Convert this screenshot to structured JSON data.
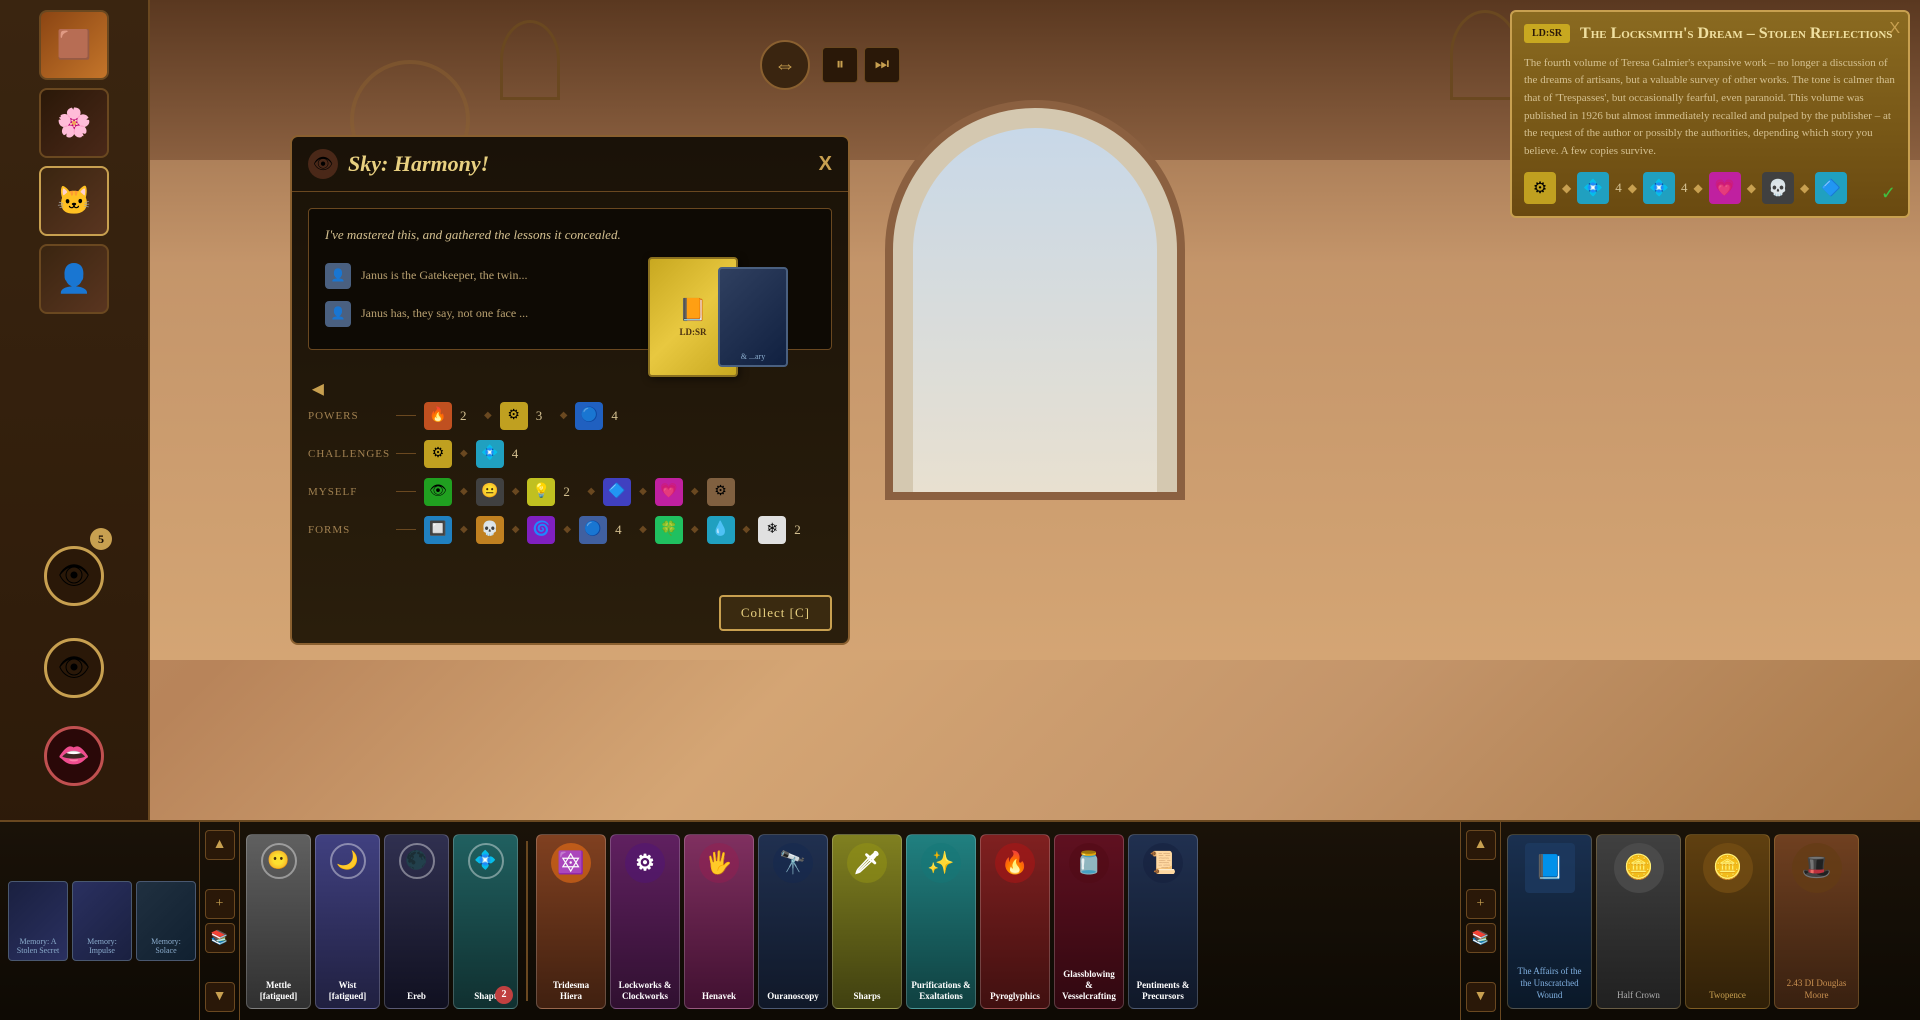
{
  "dialog": {
    "title": "Sky: Harmony!",
    "close_label": "X",
    "main_text": "I've mastered this, and gathered the lessons it concealed.",
    "list_items": [
      "Janus is the Gatekeeper, the twin...",
      "Janus has, they say, not one face ..."
    ],
    "collect_button": "Collect [C]",
    "nav_arrow": "◄",
    "stats": {
      "powers_label": "Powers",
      "challenges_label": "Challenges",
      "myself_label": "Myself",
      "forms_label": "Forms",
      "powers_values": [
        "2",
        "3",
        "4"
      ],
      "challenges_values": [
        "4"
      ],
      "myself_values": [
        "2"
      ],
      "forms_values": [
        "4",
        "2"
      ]
    }
  },
  "book_panel": {
    "badge": "LD:SR",
    "title": "The Locksmith's Dream – Stolen Reflections",
    "description": "The fourth volume of Teresa Galmier's expansive work – no longer a discussion of the dreams of artisans, but a valuable survey of other works. The tone is calmer than that of 'Trespasses', but occasionally fearful, even paranoid. This volume was published in 1926 but almost immediately recalled and pulped by the publisher – at the request of the author or possibly the authorities, depending which story you believe. A few copies survive.",
    "close_label": "X",
    "check": "✓",
    "icon_numbers": [
      "4",
      "4"
    ]
  },
  "bottom_bar": {
    "cards": [
      {
        "label": "Memory: A Stolen Secret"
      },
      {
        "label": "Memory: Impulse"
      },
      {
        "label": "Memory: Solace"
      }
    ],
    "skills": [
      {
        "name": "Mettle [fatigued]",
        "color": "skill-gray"
      },
      {
        "name": "Wist [fatigued]",
        "color": "skill-blue"
      },
      {
        "name": "Ereb",
        "color": "skill-dark"
      },
      {
        "name": "Shapt",
        "color": "skill-teal",
        "badge": "2"
      }
    ],
    "skill_categories": [
      {
        "name": "Tridesma Hiera",
        "color": "skill-orange"
      },
      {
        "name": "Lockworks & Clockworks",
        "color": "skill-purple"
      },
      {
        "name": "Henavek",
        "color": "skill-pink"
      },
      {
        "name": "Ouranoscopy",
        "color": "skill-darkblue"
      },
      {
        "name": "Sharps",
        "color": "skill-yellow"
      },
      {
        "name": "Purifications & Exaltations",
        "color": "skill-cyan"
      },
      {
        "name": "Pyroglyphics",
        "color": "skill-red"
      },
      {
        "name": "Glassblowing & Vesselcrafting",
        "color": "skill-maroon"
      },
      {
        "name": "Pentiments & Precursors",
        "color": "skill-darkblue"
      }
    ],
    "inventory": [
      {
        "name": "The Affairs of the the Unscratched Wound",
        "color": "inv-blue"
      },
      {
        "name": "Half Crown",
        "color": "inv-gray"
      },
      {
        "name": "Twopence",
        "color": "inv-gold"
      },
      {
        "name": "2.43 DI Douglas Moore",
        "color": "inv-copper"
      }
    ]
  },
  "sidebar": {
    "number": "5",
    "eye_symbol": "👁",
    "lip_symbol": "👄"
  },
  "icons": {
    "eye": "👁",
    "gear": "⚙",
    "lock": "🔒",
    "book": "📕",
    "close": "✕",
    "arrow_left": "◄",
    "arrow_right": "►",
    "arrow_up": "▲",
    "arrow_down": "▼",
    "diamond": "◆",
    "check": "✓"
  }
}
